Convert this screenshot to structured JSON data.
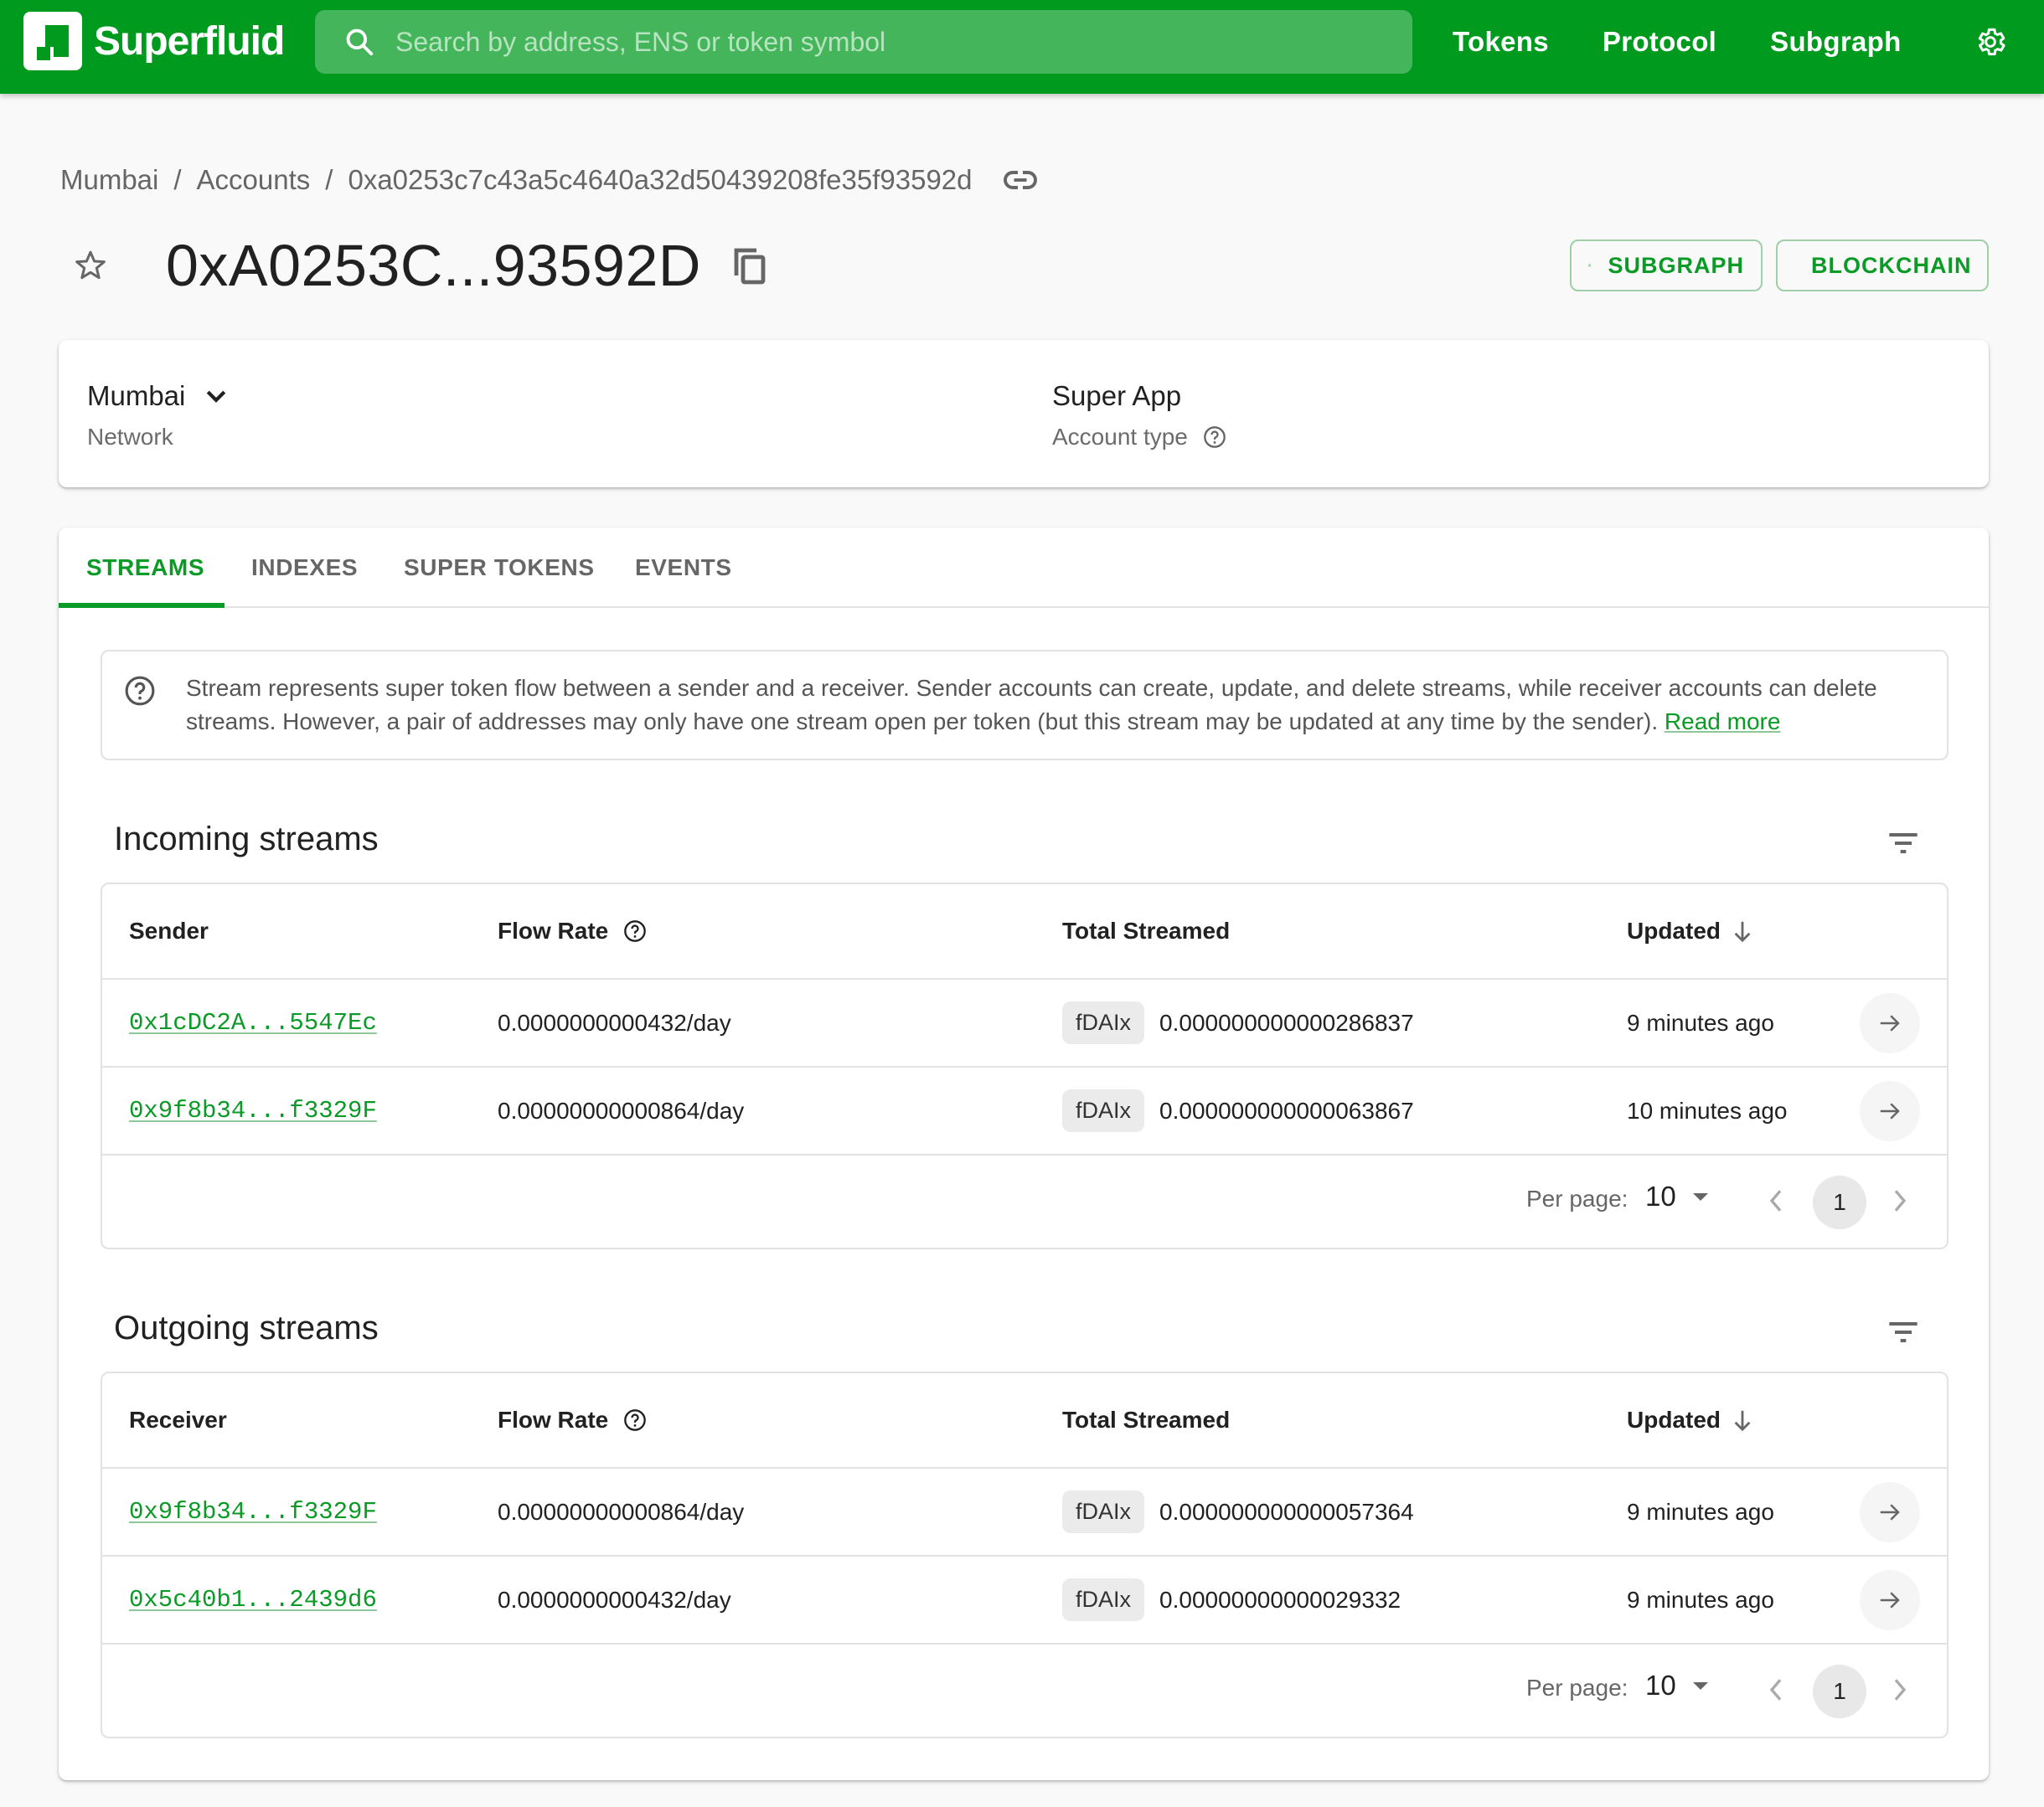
{
  "appbar": {
    "brand": "Superfluid",
    "search_placeholder": "Search by address, ENS or token symbol",
    "nav": [
      "Tokens",
      "Protocol",
      "Subgraph"
    ],
    "settings_icon": "gear-icon"
  },
  "breadcrumb": {
    "items": [
      "Mumbai",
      "Accounts",
      "0xa0253c7c43a5c4640a32d50439208fe35f93592d"
    ],
    "separator": "/"
  },
  "header": {
    "title": "0xA0253C...93592D",
    "buttons": {
      "subgraph": "SUBGRAPH",
      "blockchain": "BLOCKCHAIN"
    }
  },
  "account_info": {
    "network": {
      "value": "Mumbai",
      "label": "Network"
    },
    "account_type": {
      "value": "Super App",
      "label": "Account type"
    }
  },
  "tabs": [
    {
      "label": "STREAMS",
      "active": true
    },
    {
      "label": "INDEXES",
      "active": false
    },
    {
      "label": "SUPER TOKENS",
      "active": false
    },
    {
      "label": "EVENTS",
      "active": false
    }
  ],
  "notice": {
    "text": "Stream represents super token flow between a sender and a receiver. Sender accounts can create, update, and delete streams, while receiver accounts can delete streams. However, a pair of addresses may only have one stream open per token (but this stream may be updated at any time by the sender). ",
    "link": "Read more"
  },
  "incoming": {
    "title": "Incoming streams",
    "columns": [
      "Sender",
      "Flow Rate",
      "Total Streamed",
      "Updated"
    ],
    "rows": [
      {
        "address": "0x1cDC2A...5547Ec",
        "flow_rate": "0.0000000000432/day",
        "token": "fDAIx",
        "total": "0.000000000000286837",
        "updated": "9 minutes ago"
      },
      {
        "address": "0x9f8b34...f3329F",
        "flow_rate": "0.00000000000864/day",
        "token": "fDAIx",
        "total": "0.000000000000063867",
        "updated": "10 minutes ago"
      }
    ],
    "pagination": {
      "per_page_label": "Per page:",
      "per_page": "10",
      "page": "1"
    }
  },
  "outgoing": {
    "title": "Outgoing streams",
    "columns": [
      "Receiver",
      "Flow Rate",
      "Total Streamed",
      "Updated"
    ],
    "rows": [
      {
        "address": "0x9f8b34...f3329F",
        "flow_rate": "0.00000000000864/day",
        "token": "fDAIx",
        "total": "0.000000000000057364",
        "updated": "9 minutes ago"
      },
      {
        "address": "0x5c40b1...2439d6",
        "flow_rate": "0.0000000000432/day",
        "token": "fDAIx",
        "total": "0.00000000000029332",
        "updated": "9 minutes ago"
      }
    ],
    "pagination": {
      "per_page_label": "Per page:",
      "per_page": "10",
      "page": "1"
    }
  },
  "colors": {
    "brand": "#009a1f",
    "accent": "#0a9a26",
    "background": "#f9f9f9"
  }
}
